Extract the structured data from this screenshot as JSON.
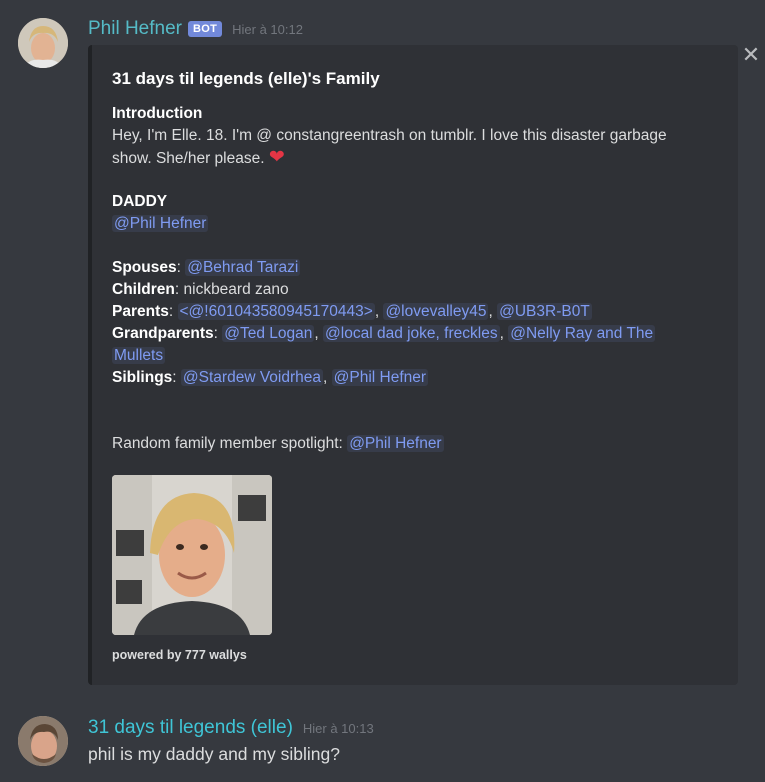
{
  "messages": [
    {
      "author": "Phil Hefner",
      "bot_tag": "BOT",
      "timestamp": "Hier à 10:12",
      "embed": {
        "title": "31 days til legends (elle)'s Family",
        "intro_label": "Introduction",
        "intro_line1": "Hey, I'm Elle. 18. I'm @ constangreentrash on tumblr. I love this disaster garbage",
        "intro_line2": "show. She/her please.",
        "daddy_label": "DADDY",
        "daddy_mention": "@Phil Hefner",
        "spouses_label": "Spouses",
        "spouses_mention": "@Behrad Tarazi",
        "children_label": "Children",
        "children_value": "nickbeard zano",
        "parents_label": "Parents",
        "parents_mentions": [
          "<@!601043580945170443>",
          "@lovevalley45",
          "@UB3R-B0T"
        ],
        "grandparents_label": "Grandparents",
        "grandparents_mentions": [
          "@Ted Logan",
          "@local dad joke, freckles",
          "@Nelly Ray and The",
          "Mullets"
        ],
        "siblings_label": "Siblings",
        "siblings_mentions": [
          "@Stardew Voidrhea",
          "@Phil Hefner"
        ],
        "spotlight_label": "Random family member spotlight:",
        "spotlight_mention": "@Phil Hefner",
        "footer": "powered by 777 wallys",
        "separator_colon": ":",
        "separator_comma": ","
      }
    },
    {
      "author": "31 days til legends (elle)",
      "timestamp": "Hier à 10:13",
      "text": "phil is my daddy and my sibling?"
    }
  ],
  "icons": {
    "close": "close-icon",
    "heart": "heart-icon"
  },
  "colors": {
    "background": "#36393f",
    "embed": "#2f3136",
    "mention": "#7f9bf2",
    "bot_tag": "#7289da",
    "author_phil": "#55bbc7",
    "author_elle": "#3fc5d6"
  }
}
